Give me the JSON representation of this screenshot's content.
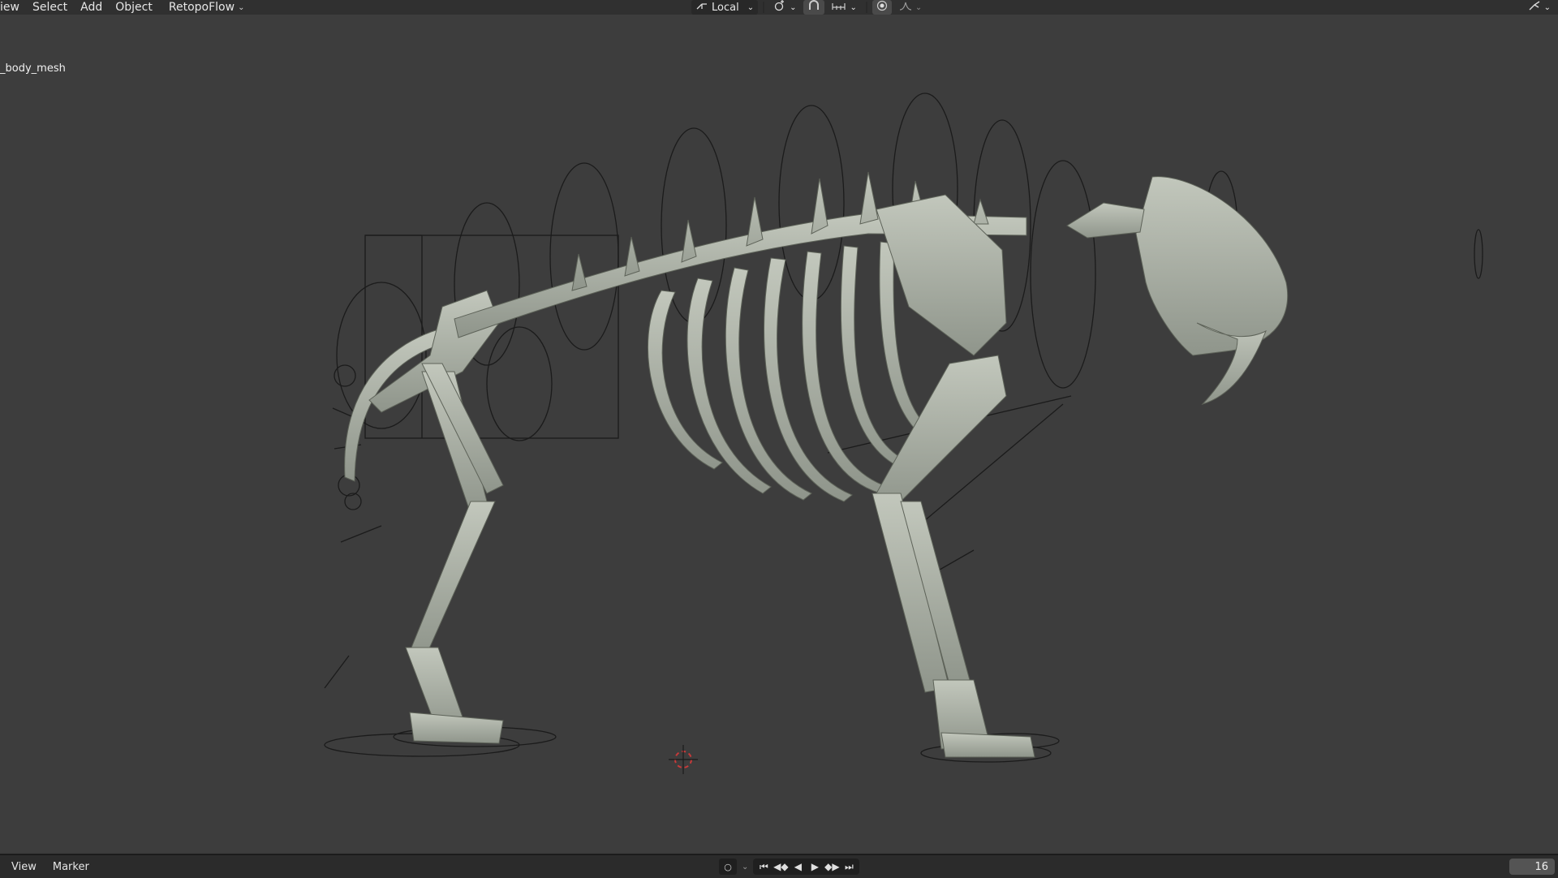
{
  "header": {
    "menu": [
      "iew",
      "Select",
      "Add",
      "Object"
    ],
    "addon_menu": "RetopoFlow",
    "transform_orientation": "Local",
    "icons": [
      "transform-orientation-icon",
      "pivot-icon",
      "snap-icon",
      "snap-increment-icon",
      "proportional-edit-icon",
      "falloff-icon",
      "gizmo-icon"
    ]
  },
  "viewport": {
    "object_name": "_body_mesh"
  },
  "timeline": {
    "menu": [
      "View",
      "Marker"
    ],
    "current_frame": "16",
    "icons": [
      "auto-keying-icon",
      "jump-start-icon",
      "prev-keyframe-icon",
      "play-reverse-icon",
      "play-icon",
      "next-keyframe-icon",
      "jump-end-icon"
    ]
  },
  "colors": {
    "viewport_bg": "#3d3d3d",
    "header_bg": "#303030",
    "bone": "#aeb3a8",
    "rig_lines": "#1a1a1a",
    "cursor_red": "#c83a3a"
  }
}
